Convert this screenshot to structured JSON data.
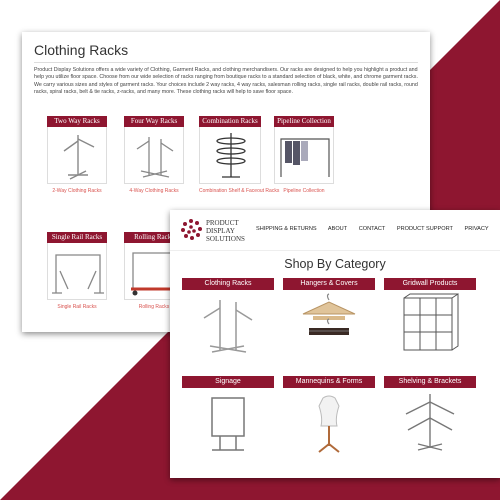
{
  "back_page": {
    "title": "Clothing Racks",
    "intro": "Product Display Solutions offers a wide variety of Clothing, Garment Racks, and clothing merchandisers. Our racks are designed to help you highlight a product and help you utilize floor space. Choose from our wide selection of racks ranging from boutique racks to a standard selection of black, white, and chrome garment racks. We carry various sizes and styles of garment racks. Your choices include 2 way racks, 4 way racks, salesman rolling racks, single rail racks, double rail racks, round racks, spiral racks, belt & tie racks, z-racks, and many more. These clothing racks will help to save floor space.",
    "categories": [
      {
        "header": "Two Way Racks",
        "caption": "2-Way Clothing Racks",
        "icon": "two-way-rack-icon"
      },
      {
        "header": "Four Way Racks",
        "caption": "4-Way Clothing Racks",
        "icon": "four-way-rack-icon"
      },
      {
        "header": "Combination Racks",
        "caption": "Combination Shelf & Faceout Racks",
        "icon": "combination-rack-icon"
      },
      {
        "header": "Pipeline Collection",
        "caption": "Pipeline Collection",
        "icon": "pipeline-rack-icon"
      },
      {
        "header": "Single Rail Racks",
        "caption": "Single Rail Racks",
        "icon": "single-rail-rack-icon"
      },
      {
        "header": "Rolling Racks",
        "caption": "Rolling Racks",
        "icon": "rolling-rack-icon"
      }
    ]
  },
  "front_page": {
    "logo_lines": [
      "PRODUCT",
      "DISPLAY",
      "SOLUTIONS"
    ],
    "nav": [
      "SHIPPING & RETURNS",
      "ABOUT",
      "CONTACT",
      "PRODUCT SUPPORT",
      "PRIVACY"
    ],
    "heading": "Shop By Category",
    "categories": [
      {
        "header": "Clothing Racks",
        "icon": "clothing-rack-icon"
      },
      {
        "header": "Hangers & Covers",
        "icon": "hanger-icon"
      },
      {
        "header": "Gridwall Products",
        "icon": "gridwall-icon"
      },
      {
        "header": "Signage",
        "icon": "sign-stand-icon"
      },
      {
        "header": "Mannequins & Forms",
        "icon": "mannequin-icon"
      },
      {
        "header": "Shelving & Brackets",
        "icon": "shelving-rack-icon"
      }
    ]
  },
  "colors": {
    "brand": "#8e1630",
    "link": "#d9534f"
  }
}
